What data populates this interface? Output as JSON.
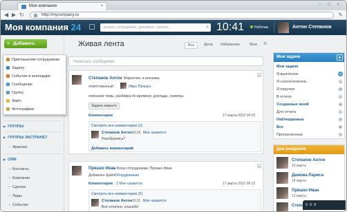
{
  "browser": {
    "tab_title": "Моя компания",
    "tab_close": "×",
    "window_controls": "– □ ×",
    "url": "http://mycompany.ru",
    "back": "◀",
    "forward": "▶",
    "reload": "↻"
  },
  "header": {
    "logo_text": "Моя компания",
    "logo_num": "24",
    "search_placeholder": "искать сотрудника, документ, прочее...",
    "clock": "10:41",
    "status": "Работаю",
    "user": "Антон Степанов"
  },
  "left": {
    "add_button": "Добавить",
    "groups": "ГРУППЫ",
    "groups_extranet": "ГРУППЫ ЭКСТРАНЕТ",
    "franchise": "Франчис",
    "crm": "CRM",
    "crm_items": [
      "Контакты",
      "Компании",
      "Сделки",
      "Лиды",
      "События"
    ]
  },
  "menu": {
    "items": [
      {
        "label": "Приглашение сотрудникам",
        "color": "#c98a2a"
      },
      {
        "label": "Задачу",
        "color": "#3a87c8"
      },
      {
        "label": "Событие в календаре",
        "color": "#e07a2c"
      },
      {
        "label": "Сообщение",
        "color": "#3aa4d8"
      },
      {
        "label": "Группу",
        "color": "#5a9bd6"
      },
      {
        "label": "Файл",
        "color": "#e8b83a"
      },
      {
        "label": "Фотографию",
        "color": "#d4a53a"
      }
    ]
  },
  "feed": {
    "title": "Живая лента",
    "filters": [
      "Все",
      "Дела",
      "Избранное",
      "Мои"
    ],
    "message_placeholder": "Написать сообщение",
    "post1": {
      "author": "Степанов Антон",
      "arrow": "→",
      "destination": "Маркетинг и реклама",
      "responsible_label": "ответственный",
      "responsible": "Иван Пряшко",
      "text": "описание темы, разбивка по времени, доклады, спикеры",
      "closed_badge": "Задача закрыта",
      "comments_link": "Комментарии",
      "date": "17 марта 2012 04:25",
      "all_comments": "Смотреть все комментарии (2)",
      "c_author": "Степанов Антон",
      "c_meta": "10:16",
      "c_like": "Мне нравится",
      "c_text": "Разобрались?",
      "add_comment": "Добавить комментарий"
    },
    "post2": {
      "author": "Пряшко Иван",
      "arrow": "→",
      "destination": "Всем сотрудникам, Пряшко Иван",
      "added_file": "Добавлен файл:",
      "file": "Оборудование",
      "comments_link": "Комментарии",
      "likes": "2 Мне нравится",
      "date": "17 марта 2012 09:12",
      "all_comments": "Смотреть все комментарии (2)",
      "c_author": "Степанов Антон",
      "c_meta": "10:11",
      "c_like": "Мне нравится",
      "c_text": "Всё отлично, спасибо!"
    }
  },
  "tasks": {
    "title": "Мои задачи",
    "rows": [
      {
        "label": "Мои задачи",
        "count": "",
        "bold": true
      },
      {
        "label": "Я выполняю",
        "count": "11",
        "blue": true
      },
      {
        "label": "Я соисполнитель",
        "count": "1"
      },
      {
        "label": "Я поручил",
        "count": "11"
      },
      {
        "label": "В отчете",
        "count": "1"
      },
      {
        "label": "Созданные мной",
        "count": "4",
        "bold": true
      },
      {
        "label": "Для отчета",
        "count": "1"
      },
      {
        "label": "Наблюдаемые",
        "count": "3",
        "bold": true
      },
      {
        "label": "Все",
        "count": "6",
        "bold": true
      },
      {
        "label": "Просроченные",
        "count": "0"
      }
    ]
  },
  "birthdays": {
    "title": "Дни рождения",
    "people": [
      {
        "name": "Степанов Антон",
        "date": "16 марта"
      },
      {
        "name": "Дамова Лариса",
        "date": "18 марта"
      },
      {
        "name": "Пряшко Иван",
        "date": "13 марта"
      },
      {
        "name": "Степанов Антон",
        "date": ""
      }
    ]
  },
  "bottom_panel": {
    "counts": "0 0 0"
  }
}
